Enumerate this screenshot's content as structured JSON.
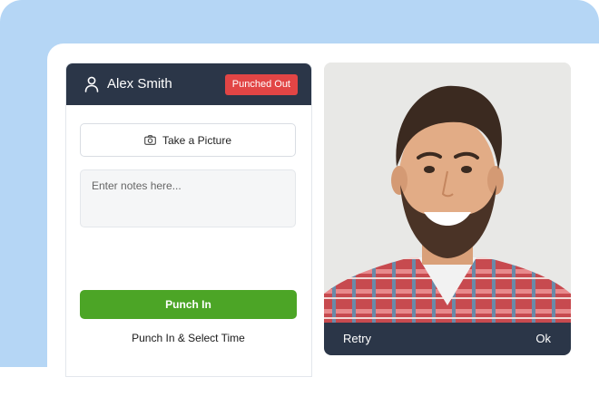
{
  "header": {
    "user_name": "Alex Smith",
    "status_badge": "Punched Out",
    "status_color": "#e24545",
    "header_color": "#2b3648"
  },
  "actions": {
    "take_picture_label": "Take a Picture",
    "notes_placeholder": "Enter notes here...",
    "notes_value": "",
    "punch_in_label": "Punch In",
    "punch_in_select_time_label": "Punch In & Select Time",
    "punch_in_color": "#4ca526"
  },
  "photo": {
    "retry_label": "Retry",
    "ok_label": "Ok"
  },
  "icons": {
    "user": "user-icon",
    "camera": "camera-icon"
  }
}
